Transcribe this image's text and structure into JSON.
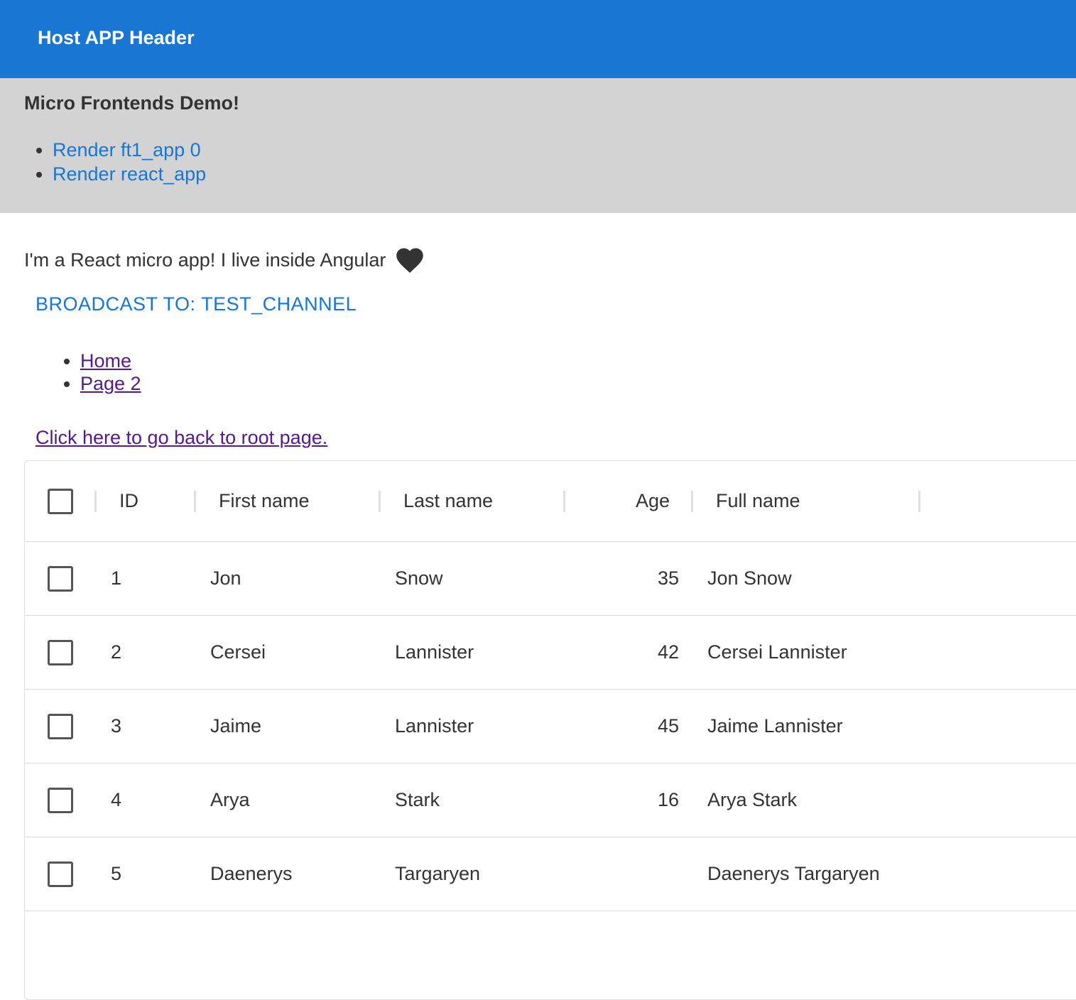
{
  "header": {
    "title": "Host APP Header"
  },
  "demo": {
    "title": "Micro Frontends Demo!",
    "links": [
      {
        "label": "Render ft1_app 0"
      },
      {
        "label": "Render react_app"
      }
    ]
  },
  "react_app": {
    "intro": "I'm a React micro app! I live inside Angular",
    "broadcast_label": "BROADCAST TO: TEST_CHANNEL",
    "nav_links": [
      {
        "label": "Home"
      },
      {
        "label": "Page 2"
      }
    ],
    "back_link": "Click here to go back to root page."
  },
  "grid": {
    "columns": [
      "ID",
      "First name",
      "Last name",
      "Age",
      "Full name"
    ],
    "rows": [
      {
        "id": "1",
        "first": "Jon",
        "last": "Snow",
        "age": "35",
        "full": "Jon Snow"
      },
      {
        "id": "2",
        "first": "Cersei",
        "last": "Lannister",
        "age": "42",
        "full": "Cersei Lannister"
      },
      {
        "id": "3",
        "first": "Jaime",
        "last": "Lannister",
        "age": "45",
        "full": "Jaime Lannister"
      },
      {
        "id": "4",
        "first": "Arya",
        "last": "Stark",
        "age": "16",
        "full": "Arya Stark"
      },
      {
        "id": "5",
        "first": "Daenerys",
        "last": "Targaryen",
        "age": "",
        "full": "Daenerys Targaryen"
      }
    ]
  },
  "icons": {
    "heart": "heart-icon",
    "checkbox": "checkbox-icon"
  },
  "colors": {
    "header_bg": "#1976d2",
    "panel_bg": "#d3d3d3",
    "link": "#1976d2",
    "visited_link": "#551a8b"
  }
}
